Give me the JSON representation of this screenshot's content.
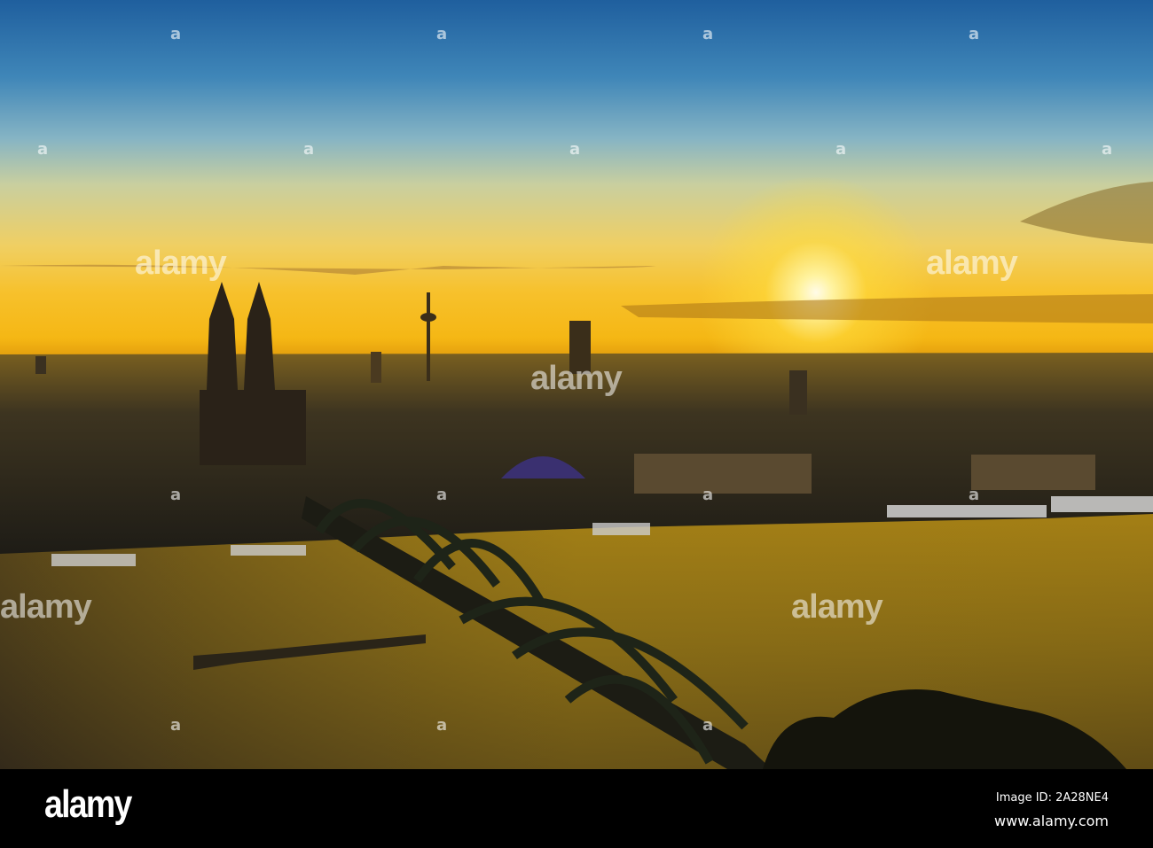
{
  "watermark": {
    "text": "alamy",
    "mark": "a"
  },
  "footer": {
    "logo": "alamy",
    "image_id": "Image ID: 2A28NE4",
    "site": "www.alamy.com"
  },
  "colors": {
    "sky_top": "#1f5f9e",
    "horizon": "#f5b714",
    "sun": "#fffbe8",
    "water": "#6b5208"
  }
}
